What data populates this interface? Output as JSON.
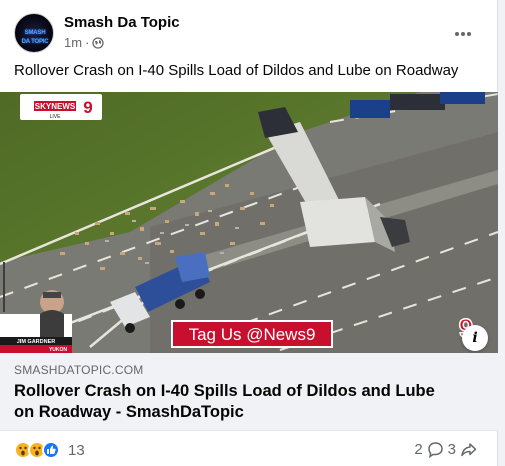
{
  "post": {
    "page_name": "Smash Da Topic",
    "timestamp": "1m",
    "separator": "·",
    "text": "Rollover Crash on I-40 Spills Load of Dildos and Lube on Roadway",
    "avatar_text": "SMASH DA TOPIC"
  },
  "media": {
    "station_logo": "SKYNEWS",
    "station_logo_number": "9",
    "station_sub": "LIVE",
    "reporter_name": "JIM GARDNER",
    "reporter_location": "YUKON",
    "banner_text": "Tag Us @News9",
    "corner_logo_number": "9",
    "info_label": "i"
  },
  "link": {
    "domain": "SMASHDATOPIC.COM",
    "title": "Rollover Crash on I-40 Spills Load of Dildos and Lube on Roadway - SmashDaTopic"
  },
  "footer": {
    "reaction_count": "13",
    "comment_count": "2",
    "share_count": "3",
    "reaction_icons": [
      "wow-icon",
      "wow-icon",
      "like-icon"
    ]
  },
  "colors": {
    "facebook_blue": "#1877f2",
    "news_red": "#c8102e",
    "grass": "#5d7a2e",
    "asphalt": "#6f6f6a"
  }
}
